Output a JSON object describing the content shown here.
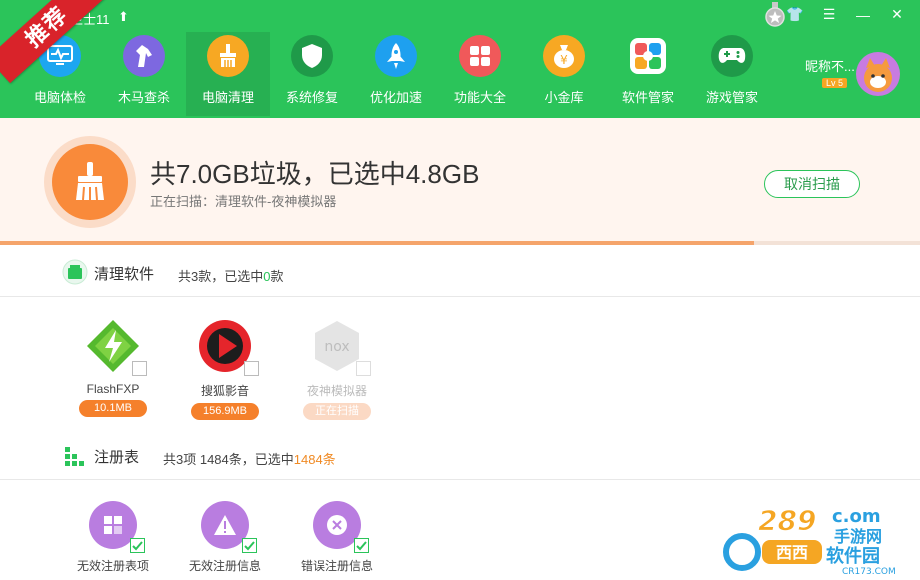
{
  "app": {
    "title": "卫士11",
    "recommend_ribbon": "推荐"
  },
  "window_controls": [
    {
      "name": "skin-icon",
      "glyph": "👕"
    },
    {
      "name": "menu-icon",
      "glyph": "☰"
    },
    {
      "name": "minimize-icon",
      "glyph": "—"
    },
    {
      "name": "close-icon",
      "glyph": "✕"
    }
  ],
  "nav": [
    {
      "label": "电脑体检",
      "icon": "monitor-checkup-icon",
      "color": "#1da6f0"
    },
    {
      "label": "木马查杀",
      "icon": "trojan-horse-icon",
      "color": "#7d68e0"
    },
    {
      "label": "电脑清理",
      "icon": "broom-icon",
      "color": "#f7a823",
      "active": true
    },
    {
      "label": "系统修复",
      "icon": "shield-icon",
      "color": "#1f9a49"
    },
    {
      "label": "优化加速",
      "icon": "rocket-icon",
      "color": "#1ea0ef"
    },
    {
      "label": "功能大全",
      "icon": "grid-icon",
      "color": "#f0595a"
    },
    {
      "label": "小金库",
      "icon": "money-bag-icon",
      "color": "#f7a823"
    },
    {
      "label": "软件管家",
      "icon": "software-manager-icon",
      "color": "#f7a823"
    },
    {
      "label": "游戏管家",
      "icon": "gamepad-icon",
      "color": "#1f9a49"
    }
  ],
  "profile": {
    "nickname": "昵称不...",
    "level": "Lv 5"
  },
  "scan": {
    "headline": "共7.0GB垃圾，已选中4.8GB",
    "status": "正在扫描：清理软件-夜神模拟器",
    "cancel_label": "取消扫描",
    "progress": 0.82
  },
  "software_section": {
    "title": "清理软件",
    "summary_prefix": "共3款，已选中",
    "summary_count": "0",
    "summary_suffix": "款",
    "items": [
      {
        "name": "FlashFXP",
        "size": "10.1MB",
        "icon": "flashfxp-icon"
      },
      {
        "name": "搜狐影音",
        "size": "156.9MB",
        "icon": "sohu-video-icon"
      },
      {
        "name": "夜神模拟器",
        "size": "正在扫描",
        "icon": "nox-icon",
        "disabled": true
      }
    ]
  },
  "registry_section": {
    "title": "注册表",
    "summary_prefix": "共3项 1484条，已选中",
    "summary_count": "1484条",
    "items": [
      {
        "name": "无效注册表项",
        "icon": "registry-grid-icon"
      },
      {
        "name": "无效注册信息",
        "icon": "warning-icon"
      },
      {
        "name": "错误注册信息",
        "icon": "error-x-icon"
      }
    ]
  },
  "watermark": {
    "line1": "289",
    "line2": "c.om",
    "line3": "手游网",
    "line4": "软件园",
    "url": "CR173.COM"
  }
}
